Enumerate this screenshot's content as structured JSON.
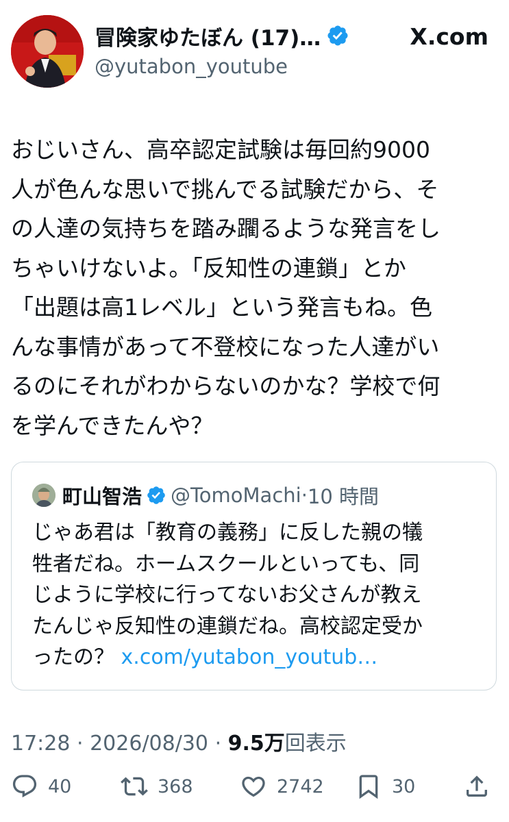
{
  "tweet": {
    "display_name": "冒険家ゆたぼん (17)…",
    "handle": "@yutabon_youtube",
    "source": "X.com",
    "text": "おじいさん、高卒認定試験は毎回約9000\n人が色んな思いで挑んでる試験だから、そ\nの人達の気持ちを踏み躙るような発言をし\nちゃいけないよ。「反知性の連鎖」とか\n「出題は高1レベル」という発言もね。色\nんな事情があって不登校になった人達がい\nるのにそれがわからないのかな？学校で何\nを学んできたんや？",
    "time": "17:28",
    "date": "2026/08/30",
    "views_count": "9.5万",
    "views_label": "回表示"
  },
  "quote": {
    "name": "町山智浩",
    "handle": "@TomoMachi",
    "time": "10 時間",
    "text": "じゃあ君は「教育の義務」に反した親の犠\n牲者だね。ホームスクールといっても、同\nじように学校に行ってないお父さんが教え\nたんじゃ反知性の連鎖だね。高校認定受か\nったの？ ",
    "link": "x.com/yutabon_youtub…"
  },
  "actions": {
    "replies": "40",
    "reposts": "368",
    "likes": "2742",
    "bookmarks": "30"
  },
  "colors": {
    "text": "#0f1419",
    "secondary": "#536471",
    "link": "#1d9bf0",
    "verified": "#1d9bf0",
    "border": "#cfd9de"
  },
  "icons": [
    "verified-badge-icon",
    "x-logo-icon",
    "reply-icon",
    "repost-icon",
    "like-icon",
    "bookmark-icon",
    "share-icon"
  ]
}
